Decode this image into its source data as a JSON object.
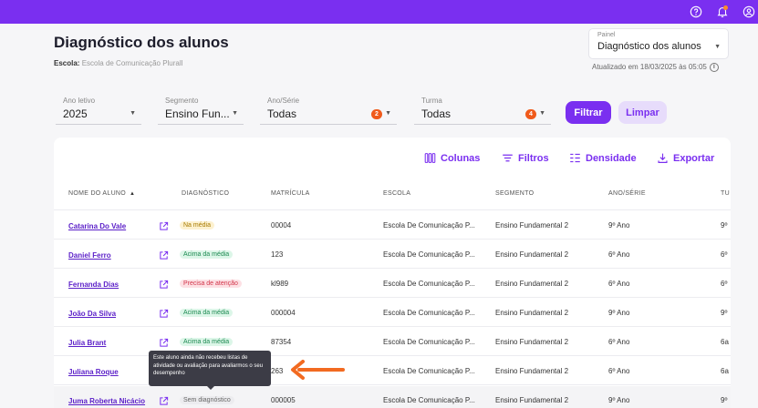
{
  "topbar": {
    "icons": [
      "help-icon",
      "bell-icon",
      "user-icon"
    ],
    "accent": "#7a2ff0"
  },
  "header": {
    "title": "Diagnóstico dos alunos",
    "school_label": "Escola:",
    "school_value": "Escola de Comunicação Plurall"
  },
  "panel": {
    "label": "Painel",
    "value": "Diagnóstico dos alunos",
    "updated": "Atualizado em 18/03/2025 às 05:05"
  },
  "filters": {
    "year": {
      "label": "Ano letivo",
      "value": "2025"
    },
    "segment": {
      "label": "Segmento",
      "value": "Ensino Fun..."
    },
    "grade": {
      "label": "Ano/Série",
      "value": "Todas",
      "badge": "2"
    },
    "class": {
      "label": "Turma",
      "value": "Todas",
      "badge": "4"
    },
    "filter_button": "Filtrar",
    "clear_button": "Limpar"
  },
  "toolbar": {
    "columns": "Colunas",
    "filters": "Filtros",
    "density": "Densidade",
    "export": "Exportar"
  },
  "table": {
    "headers": {
      "name": "NOME DO ALUNO",
      "diagnosis": "DIAGNÓSTICO",
      "registration": "MATRÍCULA",
      "school": "ESCOLA",
      "segment": "SEGMENTO",
      "grade": "ANO/SÉRIE",
      "class": "TU"
    },
    "rows": [
      {
        "name": "Catarina Do Vale",
        "diagnosis": "Na média",
        "registration": "00004",
        "school": "Escola De Comunicação P...",
        "segment": "Ensino Fundamental 2",
        "grade": "9º Ano",
        "class": "9º"
      },
      {
        "name": "Daniel Ferro",
        "diagnosis": "Acima da média",
        "registration": "123",
        "school": "Escola De Comunicação P...",
        "segment": "Ensino Fundamental 2",
        "grade": "6º Ano",
        "class": "6º"
      },
      {
        "name": "Fernanda Dias",
        "diagnosis": "Precisa de atenção",
        "registration": "kl989",
        "school": "Escola De Comunicação P...",
        "segment": "Ensino Fundamental 2",
        "grade": "6º Ano",
        "class": "6º"
      },
      {
        "name": "João Da Silva",
        "diagnosis": "Acima da média",
        "registration": "000004",
        "school": "Escola De Comunicação P...",
        "segment": "Ensino Fundamental 2",
        "grade": "9º Ano",
        "class": "9º"
      },
      {
        "name": "Julia Brant",
        "diagnosis": "Acima da média",
        "registration": "87354",
        "school": "Escola De Comunicação P...",
        "segment": "Ensino Fundamental 2",
        "grade": "6º Ano",
        "class": "6a"
      },
      {
        "name": "Juliana Roque",
        "diagnosis": "",
        "registration": "263",
        "school": "Escola De Comunicação P...",
        "segment": "Ensino Fundamental 2",
        "grade": "6º Ano",
        "class": "6a"
      },
      {
        "name": "Juma Roberta Nicácio",
        "diagnosis": "Sem diagnóstico",
        "registration": "000005",
        "school": "Escola De Comunicação P...",
        "segment": "Ensino Fundamental 2",
        "grade": "9º Ano",
        "class": "9º"
      }
    ]
  },
  "tooltip": {
    "text": "Este aluno ainda não recebeu listas de atividade ou avaliação para avaliarmos o seu desempenho"
  },
  "status_colors": {
    "na_media": {
      "bg": "#fdf1cf",
      "fg": "#a77a00"
    },
    "acima": {
      "bg": "#dcf6e8",
      "fg": "#1d8a52"
    },
    "atencao": {
      "bg": "#fde0e4",
      "fg": "#d2354a"
    },
    "sem": {
      "bg": "#ececef",
      "fg": "#666666"
    }
  },
  "annotation_arrow_color": "#f26a21"
}
